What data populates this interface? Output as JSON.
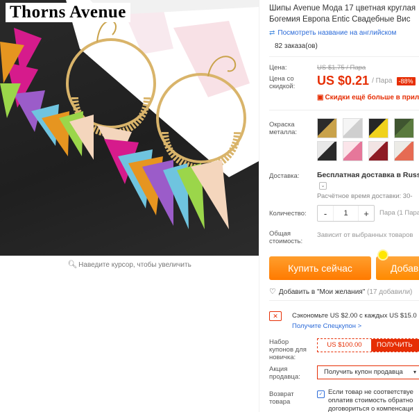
{
  "image": {
    "brand": "Thorns Avenue",
    "magnify_hint": "Наведите курсор, чтобы увеличить",
    "colors": {
      "background": "#252525",
      "magenta": "#d61b8c",
      "purple": "#9b5cc9",
      "orange": "#e69520",
      "lime": "#9bd64a",
      "sky": "#6fc4df",
      "peach": "#f4d6bd",
      "gold": "#d9b46a"
    }
  },
  "product": {
    "title": "Шипы Avenue Мода 17 цветная круглая Богемия Европа Entic Свадебные Вис",
    "translate_link": "Посмотреть название на английском",
    "orders": "82 заказа(ов)"
  },
  "price": {
    "label": "Цена:",
    "original": "US $1.75 / Пара",
    "discount_label": "Цена со скидкой:",
    "value": "US $0.21",
    "unit": "/ Пара",
    "discount_badge": "-88%",
    "coupon_hint": "Скидки ещё больше в прило"
  },
  "variants": {
    "label": "Окраска металла:",
    "swatches": [
      {
        "name": "black-gold",
        "a": "#2b2b2b",
        "b": "#c9a24a"
      },
      {
        "name": "white",
        "a": "#f5f5f5",
        "b": "#cfcfcf"
      },
      {
        "name": "yellow",
        "a": "#262626",
        "b": "#f0d21c"
      },
      {
        "name": "green",
        "a": "#3f5530",
        "b": "#5a7a3e"
      },
      {
        "name": "multi",
        "a": "#e8e8e8",
        "b": "#2a2a2a"
      },
      {
        "name": "pink",
        "a": "#fbe5ea",
        "b": "#e6779a"
      },
      {
        "name": "red",
        "a": "#f2e4e4",
        "b": "#8e1b24"
      },
      {
        "name": "coral",
        "a": "#ecebe6",
        "b": "#e66b53"
      }
    ]
  },
  "delivery": {
    "label": "Доставка:",
    "value": "Бесплатная доставка в Russia",
    "dropdown_icon": "chevron-down-icon",
    "time": "Расчётное время доставки: 30-"
  },
  "quantity": {
    "label": "Количество:",
    "value": "1",
    "minus": "-",
    "plus": "+",
    "note": "Пара (1 Пара"
  },
  "total": {
    "label": "Общая стоимость:",
    "value": "Зависит от выбранных товаров"
  },
  "actions": {
    "buy_now": "Купить сейчас",
    "add_to_cart": "Добав",
    "wishlist": "Добавить в \"Мои желания\"",
    "wishlist_count": "(17 добавили)"
  },
  "promo": {
    "text": "Сэкономьте US $2.00 с каждых US $15.0",
    "link": "Получите Спецкупон >"
  },
  "coupons": {
    "newbie_label": "Набор купонов для новичка:",
    "newbie_amount": "US $100.00",
    "newbie_claim": "ПОЛУЧИТЬ",
    "seller_label": "Акция продавца:",
    "seller_button": "Получить купон продавца",
    "return_label": "Возврат товара",
    "return_text_1": "Если товар не соответствуе",
    "return_text_2": "оплатив стоимость обратно",
    "return_text_3": "договориться о компенсаци"
  },
  "accent_colors": {
    "price_red": "#e62e04",
    "buy_orange": "#ff7a00",
    "link_blue": "#2a6ad8"
  }
}
